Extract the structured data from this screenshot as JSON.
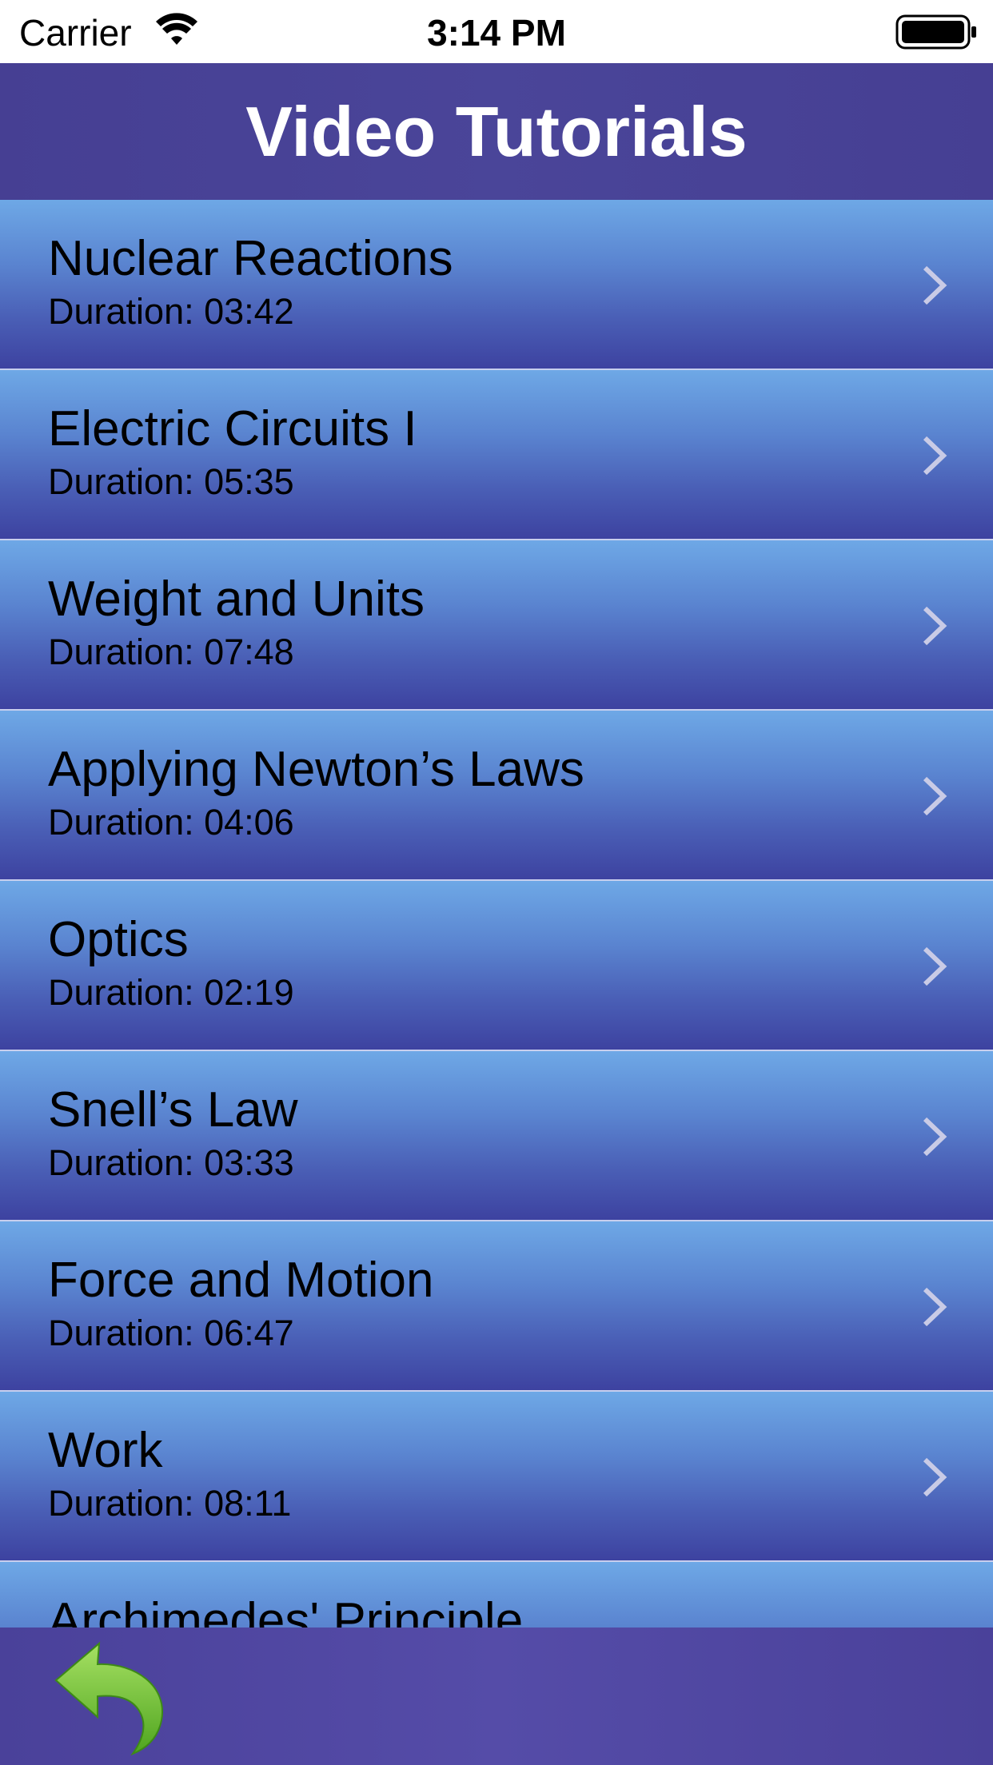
{
  "status_bar": {
    "carrier": "Carrier",
    "time": "3:14 PM",
    "icons": [
      "wifi-icon",
      "battery-icon"
    ]
  },
  "header": {
    "title": "Video Tutorials"
  },
  "videos": [
    {
      "title": "Nuclear Reactions",
      "duration": "Duration: 03:42"
    },
    {
      "title": "Electric Circuits I",
      "duration": "Duration: 05:35"
    },
    {
      "title": "Weight and Units",
      "duration": "Duration: 07:48"
    },
    {
      "title": "Applying Newton’s Laws",
      "duration": "Duration: 04:06"
    },
    {
      "title": "Optics",
      "duration": "Duration: 02:19"
    },
    {
      "title": "Snell’s Law",
      "duration": "Duration: 03:33"
    },
    {
      "title": "Force and Motion",
      "duration": "Duration: 06:47"
    },
    {
      "title": "Work",
      "duration": "Duration: 08:11"
    },
    {
      "title": "Archimedes' Principle",
      "duration": ""
    }
  ],
  "toolbar": {
    "back_icon": "back-arrow-icon"
  },
  "colors": {
    "header_bg": "#463f93",
    "row_top": "#6ea8e6",
    "row_bottom": "#3d42a0",
    "toolbar_bg": "#4a419a",
    "back_arrow": "#6cc431"
  }
}
